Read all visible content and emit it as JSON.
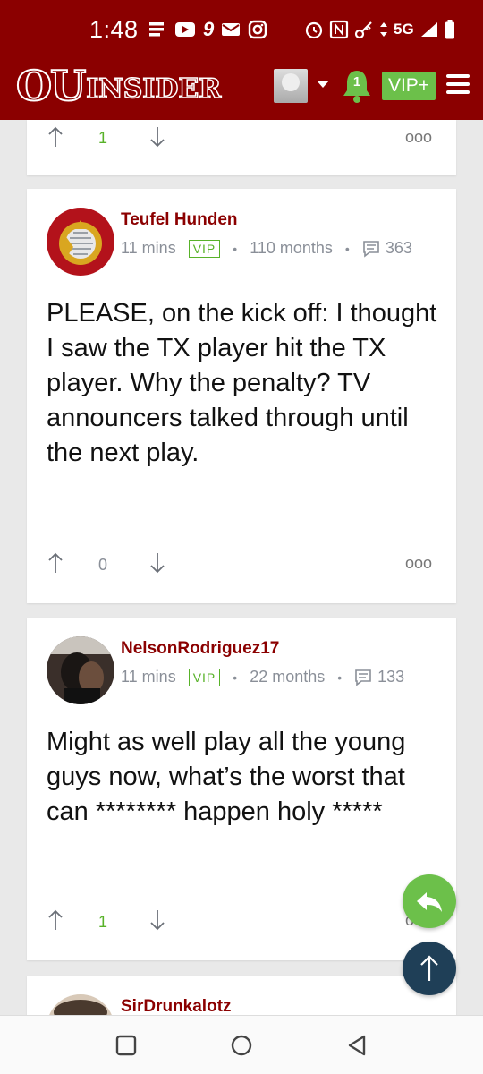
{
  "statusbar": {
    "time": "1:48",
    "network": "5G",
    "icons_left": [
      "notes-icon",
      "youtube-icon",
      "app-9-icon",
      "mail-icon",
      "instagram-icon"
    ],
    "icons_right": [
      "alarm-icon",
      "nfc-icon",
      "vpn-key-icon",
      "data-arrows-icon",
      "signal-icon",
      "battery-icon"
    ]
  },
  "header": {
    "logo_ou": "OU",
    "logo_insider": "INSIDER",
    "notification_count": "1",
    "vip_label": "VIP+"
  },
  "top_card": {
    "vote_count": "1",
    "more_label": "ooo"
  },
  "posts": [
    {
      "author": "Teufel Hunden",
      "time": "11 mins",
      "badge": "VIP",
      "tenure": "110 months",
      "post_count": "363",
      "body": "PLEASE, on the kick off: I thought I saw the TX player hit the TX player. Why the penalty? TV announcers talked through until the next play.",
      "vote_count": "0",
      "more_label": "ooo"
    },
    {
      "author": "NelsonRodriguez17",
      "time": "11 mins",
      "badge": "VIP",
      "tenure": "22 months",
      "post_count": "133",
      "body": "Might as well play all the young guys now, what’s the worst that can ******** happen holy *****",
      "vote_count": "1",
      "more_label": "ooo"
    },
    {
      "author": "SirDrunkalotz"
    }
  ],
  "colors": {
    "brand_red": "#8b0000",
    "accent_green": "#6cc04a",
    "navy": "#1f3f57",
    "meta_gray": "#8a8f98"
  }
}
